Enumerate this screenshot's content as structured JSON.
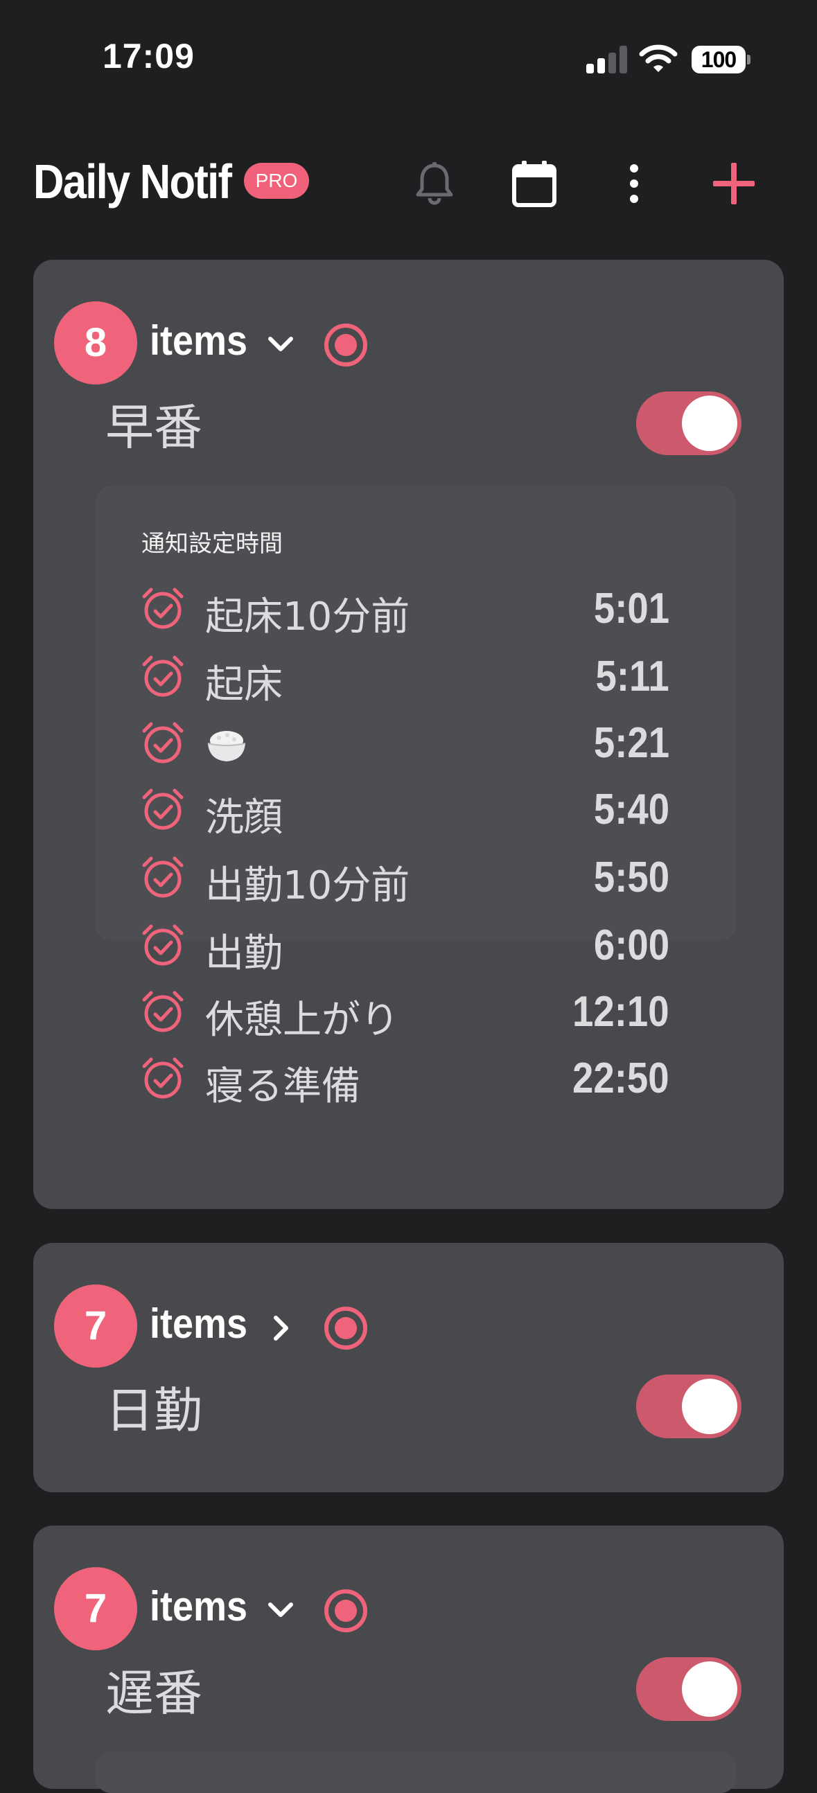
{
  "status_bar": {
    "time": "17:09",
    "battery": "100"
  },
  "header": {
    "title": "Daily Notif",
    "badge": "PRO",
    "icons": [
      "bell-icon",
      "calendar-icon",
      "more-vertical-icon",
      "plus-icon"
    ]
  },
  "colors": {
    "accent": "#f0647b",
    "background": "#1e1f21",
    "card": "#48494c",
    "panel": "#4d4e52"
  },
  "cards": [
    {
      "count": "8",
      "items_label": "items",
      "expanded": true,
      "title": "早番",
      "enabled": true,
      "panel_label": "通知設定時間",
      "schedule": [
        {
          "name": "起床10分前",
          "time": "5:01"
        },
        {
          "name": "起床",
          "time": "5:11"
        },
        {
          "name": "🍚",
          "time": "5:21"
        },
        {
          "name": "洗顔",
          "time": "5:40"
        },
        {
          "name": "出勤10分前",
          "time": "5:50"
        },
        {
          "name": "出勤",
          "time": "6:00"
        },
        {
          "name": "休憩上がり",
          "time": "12:10"
        },
        {
          "name": "寝る準備",
          "time": "22:50"
        }
      ]
    },
    {
      "count": "7",
      "items_label": "items",
      "expanded": false,
      "title": "日勤",
      "enabled": true
    },
    {
      "count": "7",
      "items_label": "items",
      "expanded": true,
      "title": "遅番",
      "enabled": true
    }
  ]
}
